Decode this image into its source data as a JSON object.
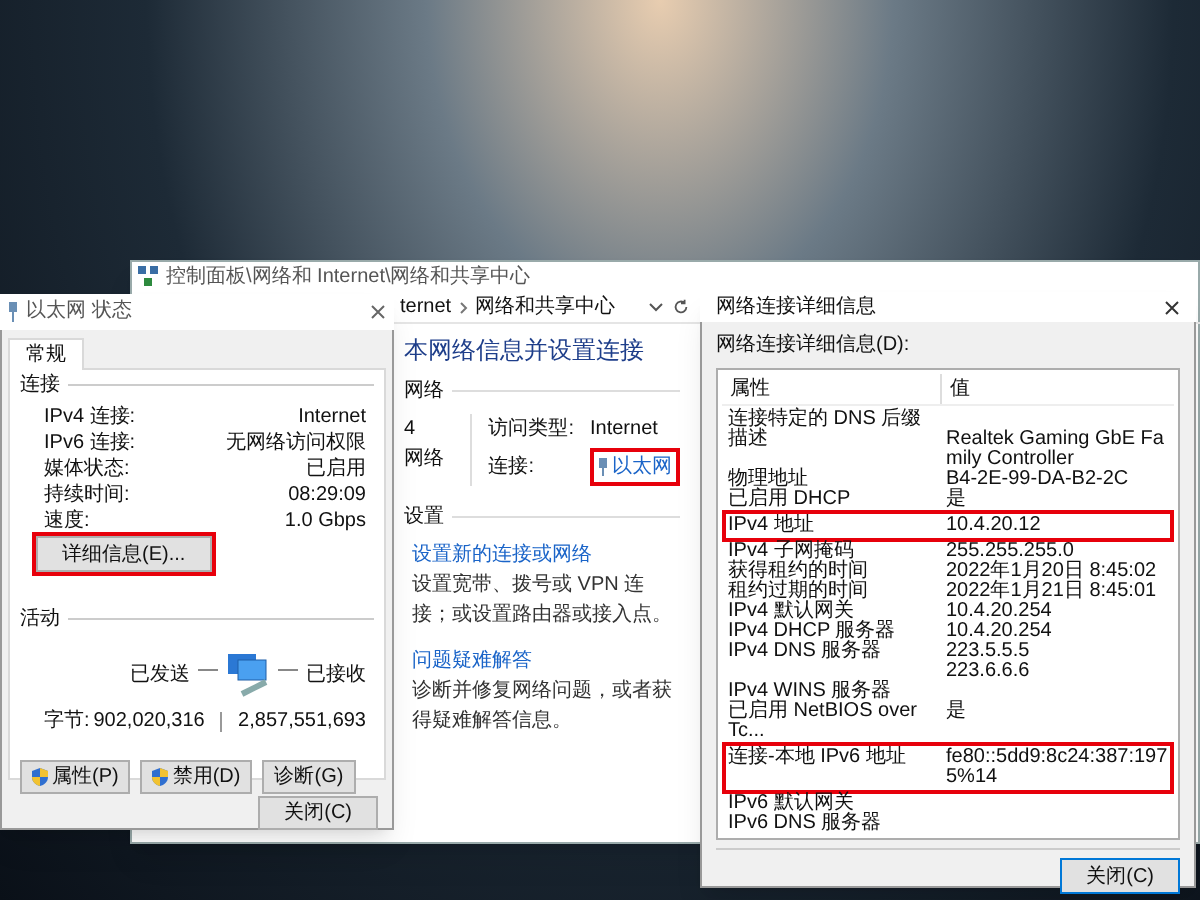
{
  "control_panel": {
    "title": "控制面板\\网络和 Internet\\网络和共享中心",
    "breadcrumb": [
      "ternet",
      "网络和共享中心"
    ],
    "heading": "本网络信息并设置连接",
    "network_section": "网络",
    "network_name": "4",
    "network_type": "网络",
    "access_type_label": "访问类型:",
    "access_type": "Internet",
    "connections_label": "连接:",
    "connection_link": {
      "text": "以太网",
      "highlighted": true
    },
    "settings_section": "设置",
    "tasks": [
      {
        "link": "设置新的连接或网络",
        "description": "设置宽带、拨号或 VPN 连接；或设置路由器或接入点。"
      },
      {
        "link": "问题疑难解答",
        "description": "诊断并修复网络问题，或者获得疑难解答信息。"
      }
    ]
  },
  "status_dialog": {
    "title": "以太网 状态",
    "tabs": [
      {
        "label": "常规",
        "selected": true
      }
    ],
    "connection_section": "连接",
    "connection_rows": [
      {
        "label": "IPv4 连接:",
        "value": "Internet"
      },
      {
        "label": "IPv6 连接:",
        "value": "无网络访问权限"
      },
      {
        "label": "媒体状态:",
        "value": "已启用"
      },
      {
        "label": "持续时间:",
        "value": "08:29:09"
      },
      {
        "label": "速度:",
        "value": "1.0 Gbps"
      }
    ],
    "details_button": {
      "label": "详细信息(E)...",
      "highlighted": true
    },
    "activity_section": "活动",
    "sent_label": "已发送",
    "received_label": "已接收",
    "bytes_label": "字节:",
    "bytes_sent": "902,020,316",
    "bytes_received": "2,857,551,693",
    "buttons": [
      {
        "label": "属性(P)",
        "kind": "shield"
      },
      {
        "label": "禁用(D)",
        "kind": "shield"
      },
      {
        "label": "诊断(G)",
        "kind": "plain"
      }
    ],
    "close_button": "关闭(C)"
  },
  "details_dialog": {
    "title": "网络连接详细信息",
    "list_label": "网络连接详细信息(D):",
    "columns": [
      "属性",
      "值"
    ],
    "rows": [
      {
        "property": "连接特定的 DNS 后缀",
        "highlighted": false
      },
      {
        "property": "描述",
        "value": "Realtek Gaming GbE Family Controller",
        "highlighted": false
      },
      {
        "property": "物理地址",
        "value": "B4-2E-99-DA-B2-2C",
        "highlighted": false
      },
      {
        "property": "已启用 DHCP",
        "value": "是",
        "highlighted": false
      },
      {
        "property": "IPv4 地址",
        "value": "10.4.20.12",
        "highlighted": true
      },
      {
        "property": "IPv4 子网掩码",
        "value": "255.255.255.0",
        "highlighted": false
      },
      {
        "property": "获得租约的时间",
        "value": "2022年1月20日 8:45:02",
        "highlighted": false
      },
      {
        "property": "租约过期的时间",
        "value": "2022年1月21日 8:45:01",
        "highlighted": false
      },
      {
        "property": "IPv4 默认网关",
        "value": "10.4.20.254",
        "highlighted": false
      },
      {
        "property": "IPv4 DHCP 服务器",
        "value": "10.4.20.254",
        "highlighted": false
      },
      {
        "property": "IPv4 DNS 服务器",
        "value": "223.5.5.5",
        "highlighted": false
      },
      {
        "value": "223.6.6.6",
        "highlighted": false
      },
      {
        "property": "IPv4 WINS 服务器",
        "highlighted": false
      },
      {
        "property": "已启用 NetBIOS over Tc...",
        "value": "是",
        "highlighted": false
      },
      {
        "property": "连接-本地 IPv6 地址",
        "value": "fe80::5dd9:8c24:387:1975%14",
        "highlighted": true
      },
      {
        "property": "IPv6 默认网关",
        "highlighted": false
      },
      {
        "property": "IPv6 DNS 服务器",
        "highlighted": false
      }
    ],
    "close_button": "关闭(C)"
  }
}
